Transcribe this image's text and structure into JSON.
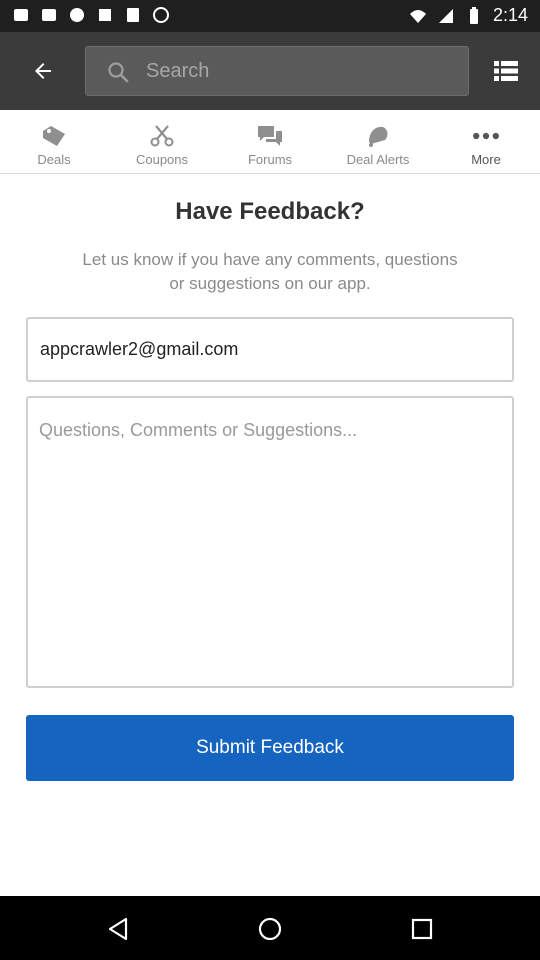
{
  "status_bar": {
    "time": "2:14"
  },
  "header": {
    "search_placeholder": "Search",
    "back_icon": "arrow-left-icon",
    "menu_icon": "list-menu-icon"
  },
  "tabs": [
    {
      "label": "Deals",
      "icon": "tag-icon"
    },
    {
      "label": "Coupons",
      "icon": "scissors-icon"
    },
    {
      "label": "Forums",
      "icon": "chat-bubbles-icon"
    },
    {
      "label": "Deal Alerts",
      "icon": "bell-icon"
    },
    {
      "label": "More",
      "icon": "more-dots-icon"
    }
  ],
  "feedback": {
    "title": "Have Feedback?",
    "subtitle": "Let us know if you have any comments, questions or suggestions on our app.",
    "email_value": "appcrawler2@gmail.com",
    "comments_placeholder": "Questions, Comments or Suggestions...",
    "submit_label": "Submit Feedback"
  },
  "colors": {
    "app_bar": "#3b3b3b",
    "accent": "#1565c0",
    "status_bar": "#1f1f1f"
  }
}
